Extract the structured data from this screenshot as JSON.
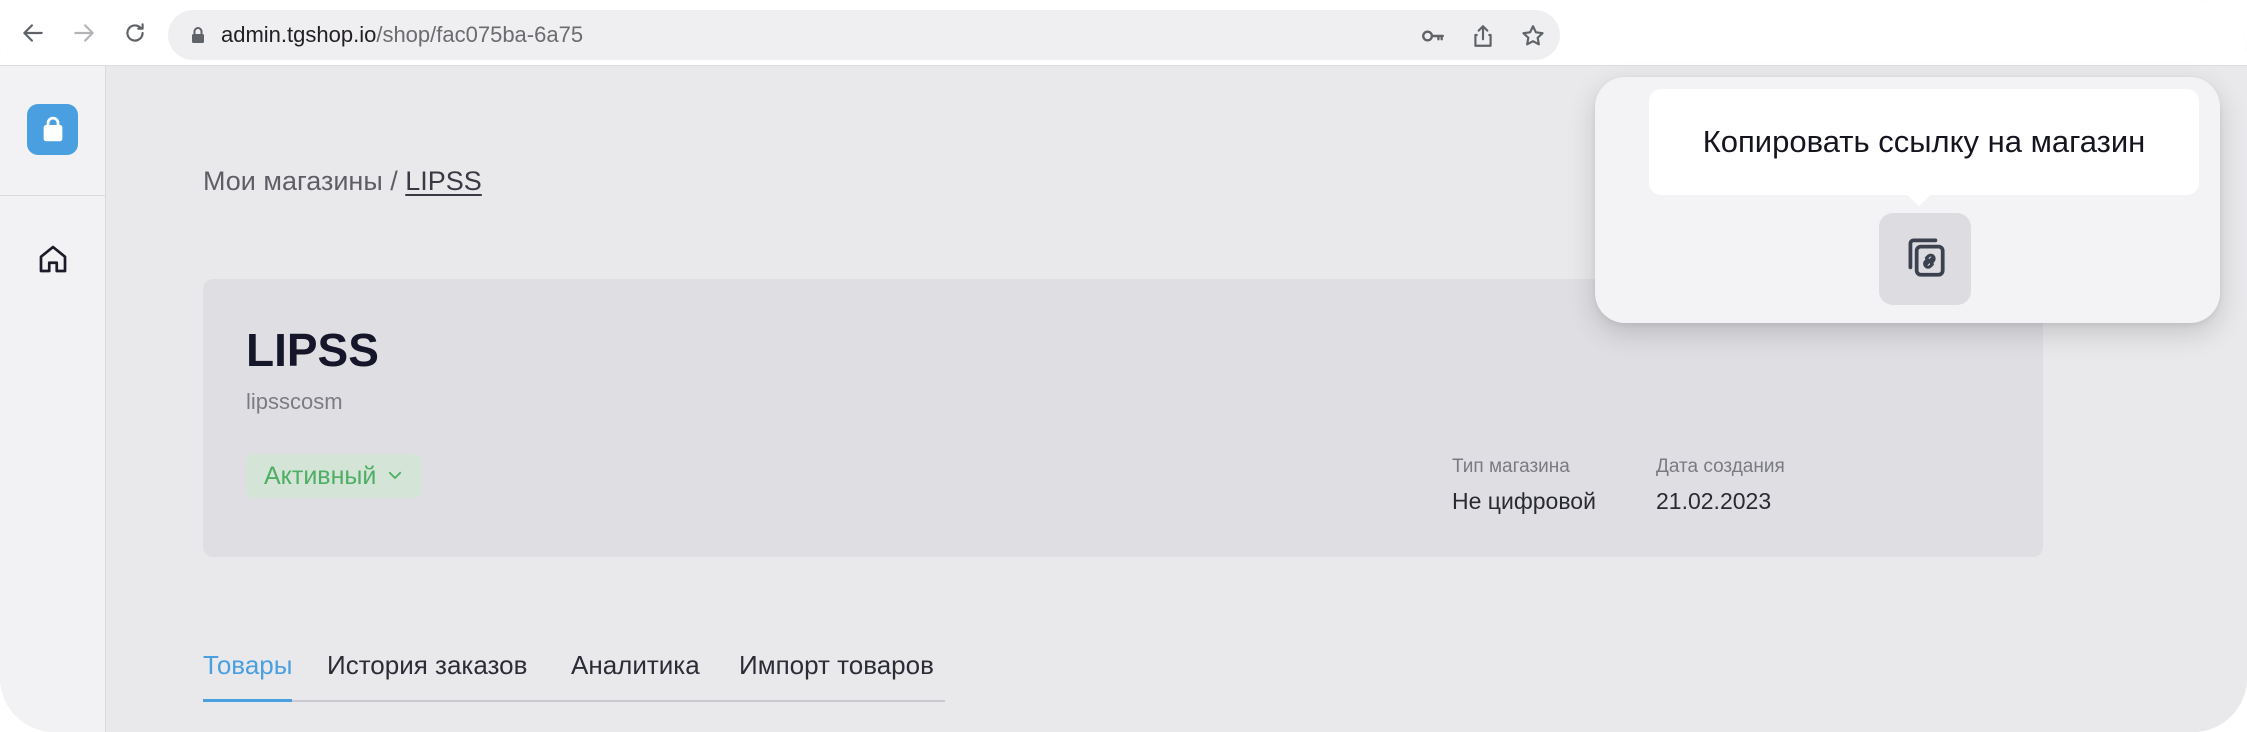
{
  "browser": {
    "url_host": "admin.tgshop.io",
    "url_path": "/shop/fac075ba-6a75"
  },
  "breadcrumb": {
    "parent": "Мои магазины",
    "separator": "/",
    "current": "LIPSS"
  },
  "shop": {
    "title": "LIPSS",
    "handle": "lipsscosm",
    "status": "Активный",
    "type_label": "Тип магазина",
    "type_value": "Не цифровой",
    "created_label": "Дата создания",
    "created_value": "21.02.2023"
  },
  "tabs": [
    {
      "label": "Товары",
      "active": true
    },
    {
      "label": "История заказов",
      "active": false
    },
    {
      "label": "Аналитика",
      "active": false
    },
    {
      "label": "Импорт товаров",
      "active": false
    }
  ],
  "tooltip": {
    "text": "Копировать ссылку на магазин"
  },
  "colors": {
    "accent": "#4a9fe0",
    "status_green": "#4caf64",
    "status_bg": "#d4e4d7"
  },
  "icons": [
    "back-icon",
    "forward-icon",
    "reload-icon",
    "lock-icon",
    "key-icon",
    "share-icon",
    "star-icon",
    "shopping-bag-icon",
    "home-icon",
    "chevron-down-icon",
    "copy-link-icon"
  ]
}
